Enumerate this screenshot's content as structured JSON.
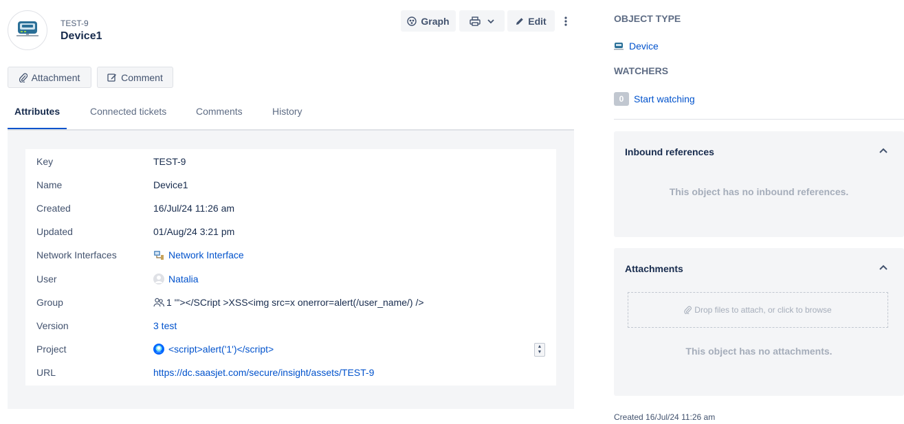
{
  "header": {
    "object_key": "TEST-9",
    "object_name": "Device1",
    "avatar_icon": "device-icon",
    "graph_label": "Graph",
    "edit_label": "Edit"
  },
  "actions": {
    "attachment_label": "Attachment",
    "comment_label": "Comment"
  },
  "tabs": [
    {
      "label": "Attributes",
      "active": true
    },
    {
      "label": "Connected tickets",
      "active": false
    },
    {
      "label": "Comments",
      "active": false
    },
    {
      "label": "History",
      "active": false
    }
  ],
  "attributes": [
    {
      "key": "Key",
      "value": "TEST-9",
      "type": "text"
    },
    {
      "key": "Name",
      "value": "Device1",
      "type": "text"
    },
    {
      "key": "Created",
      "value": "16/Jul/24 11:26 am",
      "type": "text"
    },
    {
      "key": "Updated",
      "value": "01/Aug/24 3:21 pm",
      "type": "text"
    },
    {
      "key": "Network Interfaces",
      "value": "Network Interface",
      "type": "link",
      "icon": "network-interface-icon"
    },
    {
      "key": "User",
      "value": "Natalia",
      "type": "link",
      "icon": "user-avatar-icon"
    },
    {
      "key": "Group",
      "value": "1 '\"></SCript >XSS<img src=x onerror=alert(/user_name/) />",
      "type": "text",
      "icon": "group-icon"
    },
    {
      "key": "Version",
      "value": "3 test",
      "type": "link"
    },
    {
      "key": "Project",
      "value": "<script>alert('1')</script>",
      "type": "link",
      "icon": "project-icon"
    },
    {
      "key": "URL",
      "value": "https://dc.saasjet.com/secure/insight/assets/TEST-9",
      "type": "link"
    }
  ],
  "sidebar": {
    "object_type_heading": "OBJECT TYPE",
    "object_type_value": "Device",
    "watchers_heading": "WATCHERS",
    "watchers_count": "0",
    "start_watching_label": "Start watching",
    "inbound_title": "Inbound references",
    "inbound_empty": "This object has no inbound references.",
    "attachments_title": "Attachments",
    "dropzone_text": "Drop files to attach, or click to browse",
    "attachments_empty": "This object has no attachments.",
    "created_footer": "Created 16/Jul/24 11:26 am"
  },
  "colors": {
    "link": "#0052cc",
    "text": "#172b4d",
    "muted": "#5e6c84",
    "panel_bg": "#f4f5f7"
  }
}
